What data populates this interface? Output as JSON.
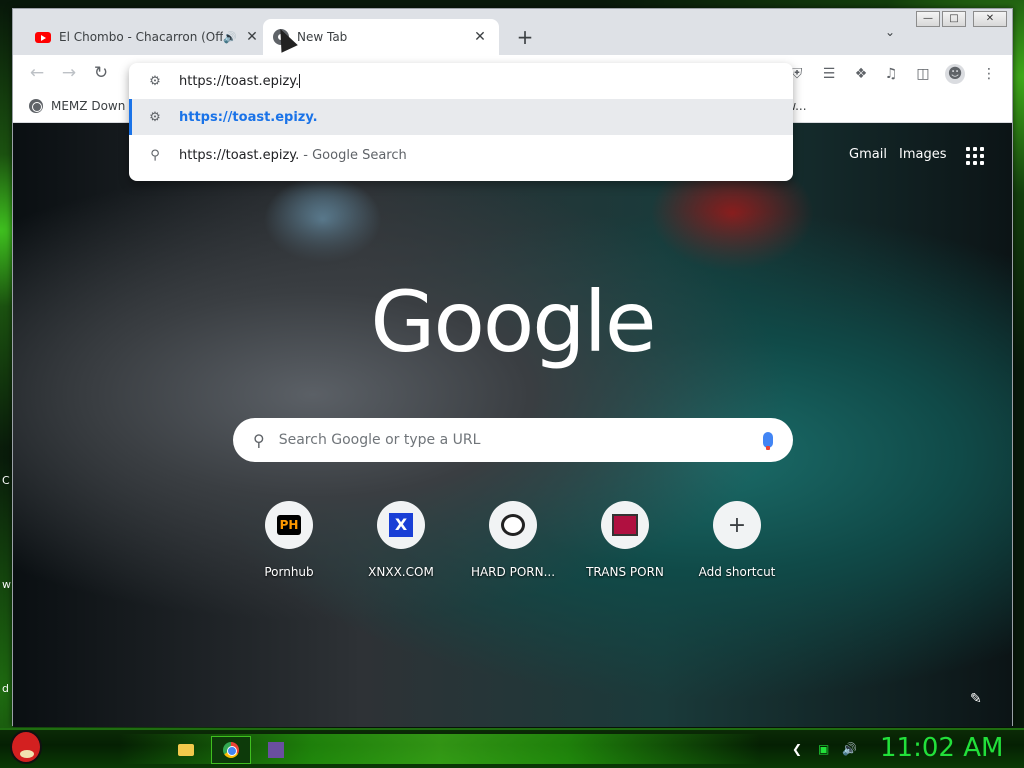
{
  "browser": {
    "tabs": [
      {
        "label": "El Chombo - Chacarron (Offi"
      },
      {
        "label": "New Tab"
      }
    ],
    "new_tab_symbol": "+",
    "close_symbol": "✕"
  },
  "omnibox": {
    "input_value": "https://toast.epizy.",
    "suggestions": [
      {
        "text": "https://toast.epizy."
      },
      {
        "text": "https://toast.epizy.",
        "suffix": "- Google Search"
      }
    ]
  },
  "bookmarks": [
    {
      "label": "MEMZ Down"
    },
    {
      "label": "ew..."
    }
  ],
  "ntp": {
    "gmail_label": "Gmail",
    "images_label": "Images",
    "logo_text": "Google",
    "search_placeholder": "Search Google or type a URL",
    "shortcuts": [
      {
        "label": "Pornhub",
        "icon_text": "PH"
      },
      {
        "label": "XNXX.COM",
        "icon_text": "X"
      },
      {
        "label": "HARD PORN..."
      },
      {
        "label": "TRANS PORN"
      },
      {
        "label": "Add shortcut",
        "icon_text": "+"
      }
    ]
  },
  "taskbar": {
    "clock": "11:02 AM"
  },
  "colors": {
    "accent": "#1a73e8",
    "clock_green": "#22e03a",
    "youtube_red": "#ff0000"
  }
}
